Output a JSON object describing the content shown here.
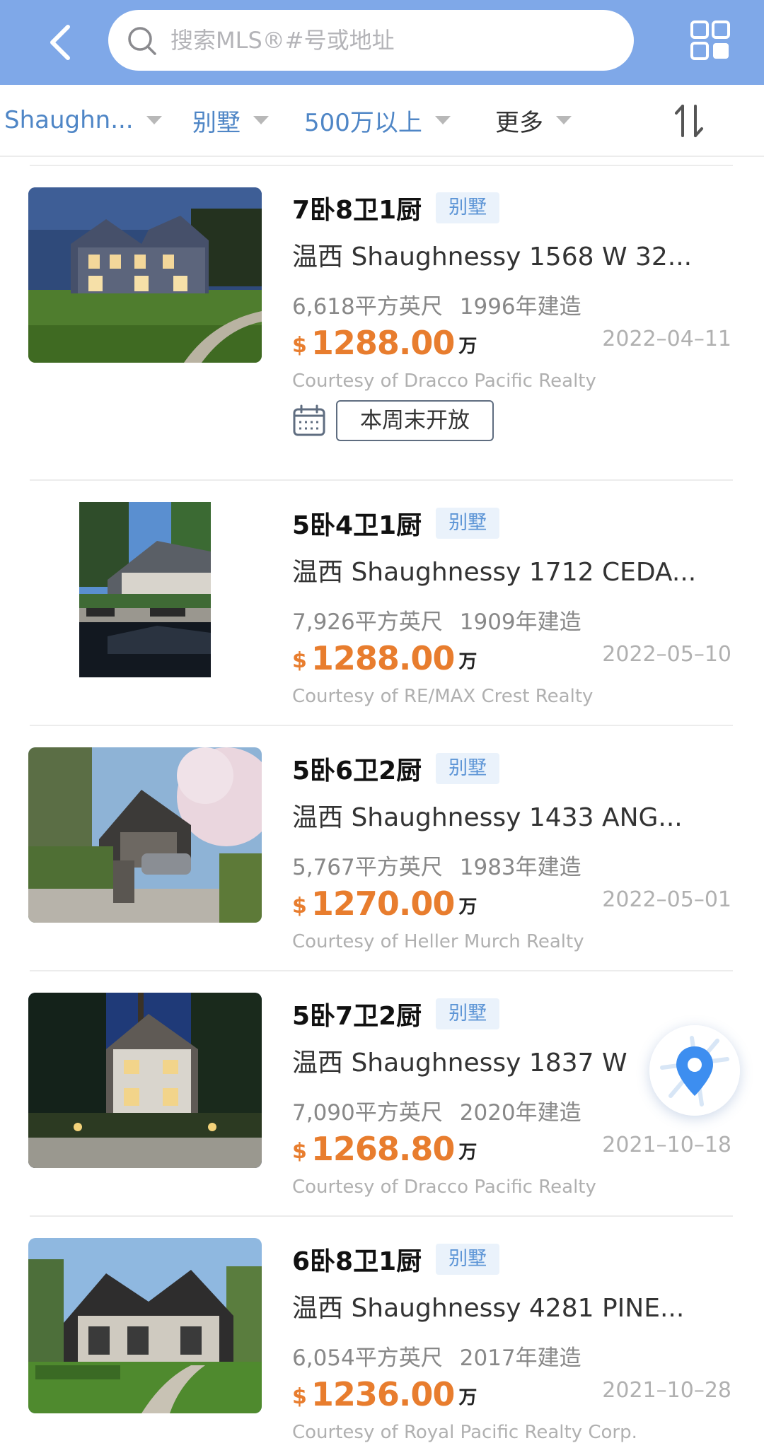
{
  "search": {
    "placeholder": "搜索MLS®#号或地址"
  },
  "filters": [
    {
      "label": "Shaughn...",
      "active": true
    },
    {
      "label": "别墅",
      "active": true
    },
    {
      "label": "500万以上",
      "active": true
    },
    {
      "label": "更多",
      "active": false
    }
  ],
  "icons": {
    "back": "back-arrow-icon",
    "search": "search-icon",
    "layout": "grid-layout-icon",
    "sort": "sort-icon",
    "calendar": "calendar-icon",
    "map": "map-pin-icon"
  },
  "colors": {
    "header": "#7fa8e8",
    "accent_blue": "#4f86c6",
    "price": "#e87d2e",
    "badge_bg": "#eaf2fb",
    "badge_text": "#5d95d6",
    "muted": "#b0b0b0"
  },
  "listings": [
    {
      "title": "7卧8卫1厨",
      "type": "别墅",
      "address": "温西 Shaughnessy  1568 W 32...",
      "area": "6,618平方英尺",
      "built": "1996年建造",
      "currency": "$",
      "price": "1288.00",
      "unit": "万",
      "date": "2022–04–11",
      "courtesy": "Courtesy of Dracco Pacific Realty",
      "openhouse": "本周末开放"
    },
    {
      "title": "5卧4卫1厨",
      "type": "别墅",
      "address": "温西 Shaughnessy  1712 CEDA...",
      "area": "7,926平方英尺",
      "built": "1909年建造",
      "currency": "$",
      "price": "1288.00",
      "unit": "万",
      "date": "2022–05–10",
      "courtesy": "Courtesy of RE/MAX Crest Realty"
    },
    {
      "title": "5卧6卫2厨",
      "type": "别墅",
      "address": "温西 Shaughnessy  1433 ANG...",
      "area": "5,767平方英尺",
      "built": "1983年建造",
      "currency": "$",
      "price": "1270.00",
      "unit": "万",
      "date": "2022–05–01",
      "courtesy": "Courtesy of Heller Murch Realty"
    },
    {
      "title": "5卧7卫2厨",
      "type": "别墅",
      "address": "温西 Shaughnessy  1837 W",
      "area": "7,090平方英尺",
      "built": "2020年建造",
      "currency": "$",
      "price": "1268.80",
      "unit": "万",
      "date": "2021–10–18",
      "courtesy": "Courtesy of Dracco Pacific Realty"
    },
    {
      "title": "6卧8卫1厨",
      "type": "别墅",
      "address": "温西 Shaughnessy  4281 PINE...",
      "area": "6,054平方英尺",
      "built": "2017年建造",
      "currency": "$",
      "price": "1236.00",
      "unit": "万",
      "date": "2021–10–28",
      "courtesy": "Courtesy of Royal Pacific Realty Corp."
    }
  ]
}
